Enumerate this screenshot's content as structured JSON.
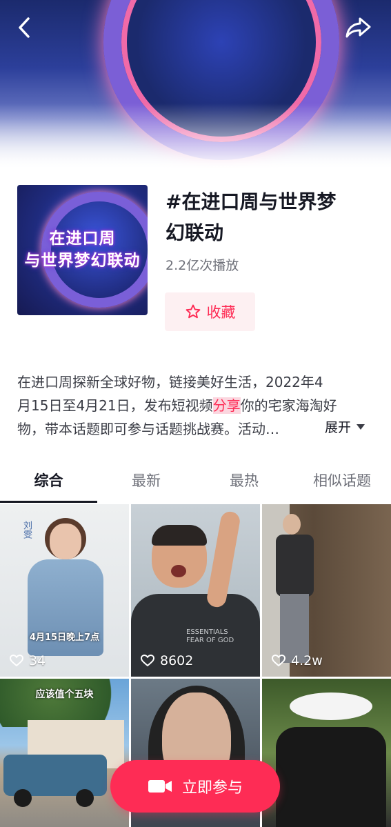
{
  "hero": {
    "back_icon": "chevron-left-icon",
    "share_icon": "share-arrow-icon"
  },
  "topic": {
    "cover_line1": "在进口周",
    "cover_line2": "与世界梦幻联动",
    "title_line1": "#在进口周与世界梦",
    "title_line2": "幻联动",
    "plays": "2.2亿次播放",
    "favorite_label": "收藏",
    "favorite_icon": "star-outline-icon"
  },
  "description": {
    "line1": "在进口周探新全球好物，链接美好生活，2022年4",
    "line2_pre": "月15日至4月21日，发布短视频",
    "line2_hl": "分享",
    "line2_post": "你的宅家海淘好",
    "line3": "物，带本话题即可参与话题挑战赛。活动…",
    "expand_label": "展开",
    "expand_icon": "triangle-down-icon"
  },
  "tabs": [
    {
      "label": "综合"
    },
    {
      "label": "最新"
    },
    {
      "label": "最热"
    },
    {
      "label": "相似话题"
    }
  ],
  "videos": [
    {
      "likes": "34",
      "overlay_caption": "4月15日晚上7点",
      "side_name": "刘雯"
    },
    {
      "likes": "8602",
      "shirt_text": "ESSENTIALS FEAR OF GOD"
    },
    {
      "likes": "4.2w"
    },
    {
      "overlay_caption": "应该值个五块"
    },
    {},
    {}
  ],
  "cta": {
    "label": "立即参与",
    "icon": "video-camera-icon"
  },
  "colors": {
    "accent": "#fe2c55",
    "favorite_bg": "#fdf0f2",
    "text_primary": "#161823",
    "text_secondary": "#6e7079"
  }
}
